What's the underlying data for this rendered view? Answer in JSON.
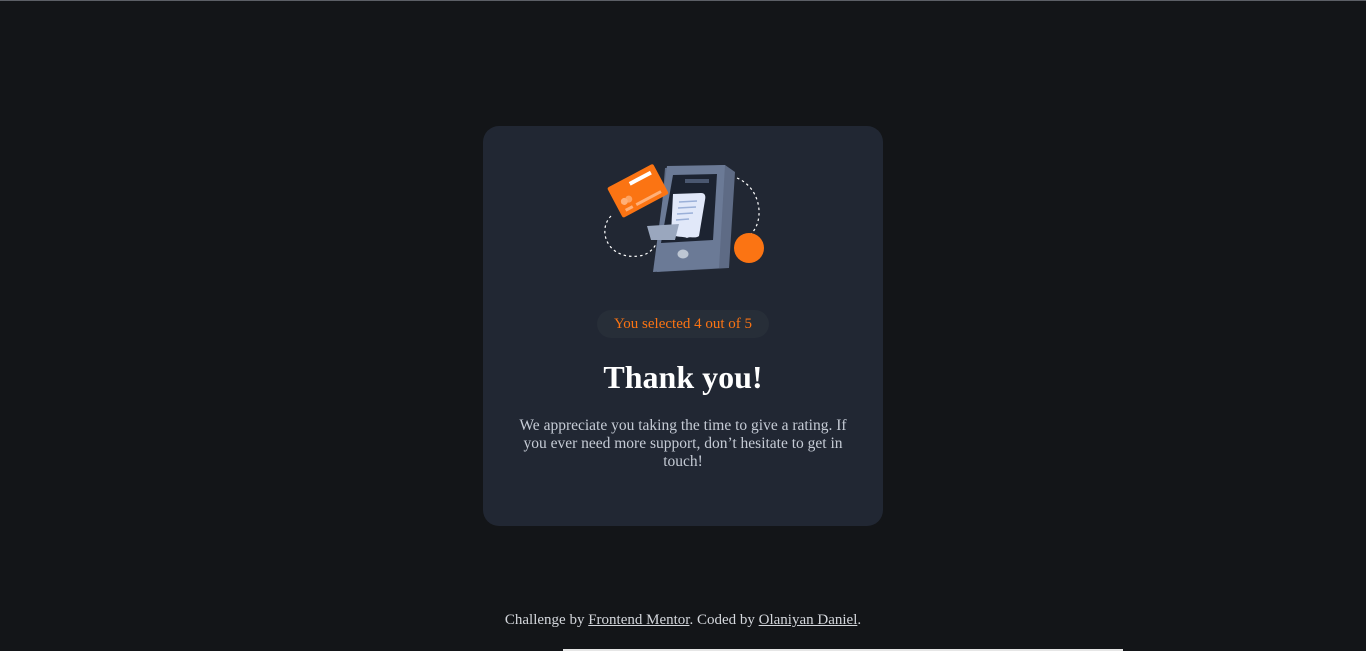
{
  "card": {
    "badge_text": "You selected 4 out of 5",
    "title": "Thank you!",
    "message": "We appreciate you taking the time to give a rating. If you ever need more support, don’t hesitate to get in touch!"
  },
  "footer": {
    "prefix": "Challenge by ",
    "link1_text": "Frontend Mentor",
    "middle": ". Coded by ",
    "link2_text": "Olaniyan Daniel",
    "suffix": "."
  },
  "colors": {
    "page_background": "#131518",
    "card_background": "#212733",
    "accent": "#fb7413",
    "heading": "#ffffff",
    "body_text": "#c5cbd5"
  },
  "icons": {
    "illustration": "thank-you-phone-illustration"
  }
}
